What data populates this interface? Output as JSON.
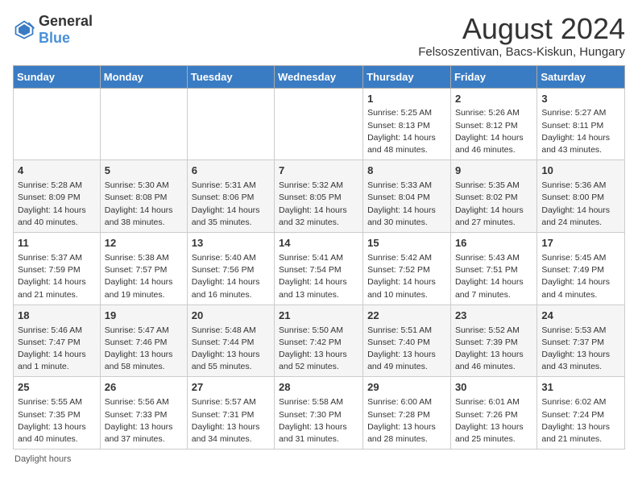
{
  "header": {
    "logo_general": "General",
    "logo_blue": "Blue",
    "month_title": "August 2024",
    "location": "Felsoszentivan, Bacs-Kiskun, Hungary"
  },
  "days_of_week": [
    "Sunday",
    "Monday",
    "Tuesday",
    "Wednesday",
    "Thursday",
    "Friday",
    "Saturday"
  ],
  "weeks": [
    [
      {
        "day": "",
        "info": ""
      },
      {
        "day": "",
        "info": ""
      },
      {
        "day": "",
        "info": ""
      },
      {
        "day": "",
        "info": ""
      },
      {
        "day": "1",
        "info": "Sunrise: 5:25 AM\nSunset: 8:13 PM\nDaylight: 14 hours\nand 48 minutes."
      },
      {
        "day": "2",
        "info": "Sunrise: 5:26 AM\nSunset: 8:12 PM\nDaylight: 14 hours\nand 46 minutes."
      },
      {
        "day": "3",
        "info": "Sunrise: 5:27 AM\nSunset: 8:11 PM\nDaylight: 14 hours\nand 43 minutes."
      }
    ],
    [
      {
        "day": "4",
        "info": "Sunrise: 5:28 AM\nSunset: 8:09 PM\nDaylight: 14 hours\nand 40 minutes."
      },
      {
        "day": "5",
        "info": "Sunrise: 5:30 AM\nSunset: 8:08 PM\nDaylight: 14 hours\nand 38 minutes."
      },
      {
        "day": "6",
        "info": "Sunrise: 5:31 AM\nSunset: 8:06 PM\nDaylight: 14 hours\nand 35 minutes."
      },
      {
        "day": "7",
        "info": "Sunrise: 5:32 AM\nSunset: 8:05 PM\nDaylight: 14 hours\nand 32 minutes."
      },
      {
        "day": "8",
        "info": "Sunrise: 5:33 AM\nSunset: 8:04 PM\nDaylight: 14 hours\nand 30 minutes."
      },
      {
        "day": "9",
        "info": "Sunrise: 5:35 AM\nSunset: 8:02 PM\nDaylight: 14 hours\nand 27 minutes."
      },
      {
        "day": "10",
        "info": "Sunrise: 5:36 AM\nSunset: 8:00 PM\nDaylight: 14 hours\nand 24 minutes."
      }
    ],
    [
      {
        "day": "11",
        "info": "Sunrise: 5:37 AM\nSunset: 7:59 PM\nDaylight: 14 hours\nand 21 minutes."
      },
      {
        "day": "12",
        "info": "Sunrise: 5:38 AM\nSunset: 7:57 PM\nDaylight: 14 hours\nand 19 minutes."
      },
      {
        "day": "13",
        "info": "Sunrise: 5:40 AM\nSunset: 7:56 PM\nDaylight: 14 hours\nand 16 minutes."
      },
      {
        "day": "14",
        "info": "Sunrise: 5:41 AM\nSunset: 7:54 PM\nDaylight: 14 hours\nand 13 minutes."
      },
      {
        "day": "15",
        "info": "Sunrise: 5:42 AM\nSunset: 7:52 PM\nDaylight: 14 hours\nand 10 minutes."
      },
      {
        "day": "16",
        "info": "Sunrise: 5:43 AM\nSunset: 7:51 PM\nDaylight: 14 hours\nand 7 minutes."
      },
      {
        "day": "17",
        "info": "Sunrise: 5:45 AM\nSunset: 7:49 PM\nDaylight: 14 hours\nand 4 minutes."
      }
    ],
    [
      {
        "day": "18",
        "info": "Sunrise: 5:46 AM\nSunset: 7:47 PM\nDaylight: 14 hours\nand 1 minute."
      },
      {
        "day": "19",
        "info": "Sunrise: 5:47 AM\nSunset: 7:46 PM\nDaylight: 13 hours\nand 58 minutes."
      },
      {
        "day": "20",
        "info": "Sunrise: 5:48 AM\nSunset: 7:44 PM\nDaylight: 13 hours\nand 55 minutes."
      },
      {
        "day": "21",
        "info": "Sunrise: 5:50 AM\nSunset: 7:42 PM\nDaylight: 13 hours\nand 52 minutes."
      },
      {
        "day": "22",
        "info": "Sunrise: 5:51 AM\nSunset: 7:40 PM\nDaylight: 13 hours\nand 49 minutes."
      },
      {
        "day": "23",
        "info": "Sunrise: 5:52 AM\nSunset: 7:39 PM\nDaylight: 13 hours\nand 46 minutes."
      },
      {
        "day": "24",
        "info": "Sunrise: 5:53 AM\nSunset: 7:37 PM\nDaylight: 13 hours\nand 43 minutes."
      }
    ],
    [
      {
        "day": "25",
        "info": "Sunrise: 5:55 AM\nSunset: 7:35 PM\nDaylight: 13 hours\nand 40 minutes."
      },
      {
        "day": "26",
        "info": "Sunrise: 5:56 AM\nSunset: 7:33 PM\nDaylight: 13 hours\nand 37 minutes."
      },
      {
        "day": "27",
        "info": "Sunrise: 5:57 AM\nSunset: 7:31 PM\nDaylight: 13 hours\nand 34 minutes."
      },
      {
        "day": "28",
        "info": "Sunrise: 5:58 AM\nSunset: 7:30 PM\nDaylight: 13 hours\nand 31 minutes."
      },
      {
        "day": "29",
        "info": "Sunrise: 6:00 AM\nSunset: 7:28 PM\nDaylight: 13 hours\nand 28 minutes."
      },
      {
        "day": "30",
        "info": "Sunrise: 6:01 AM\nSunset: 7:26 PM\nDaylight: 13 hours\nand 25 minutes."
      },
      {
        "day": "31",
        "info": "Sunrise: 6:02 AM\nSunset: 7:24 PM\nDaylight: 13 hours\nand 21 minutes."
      }
    ]
  ],
  "footer": "Daylight hours"
}
